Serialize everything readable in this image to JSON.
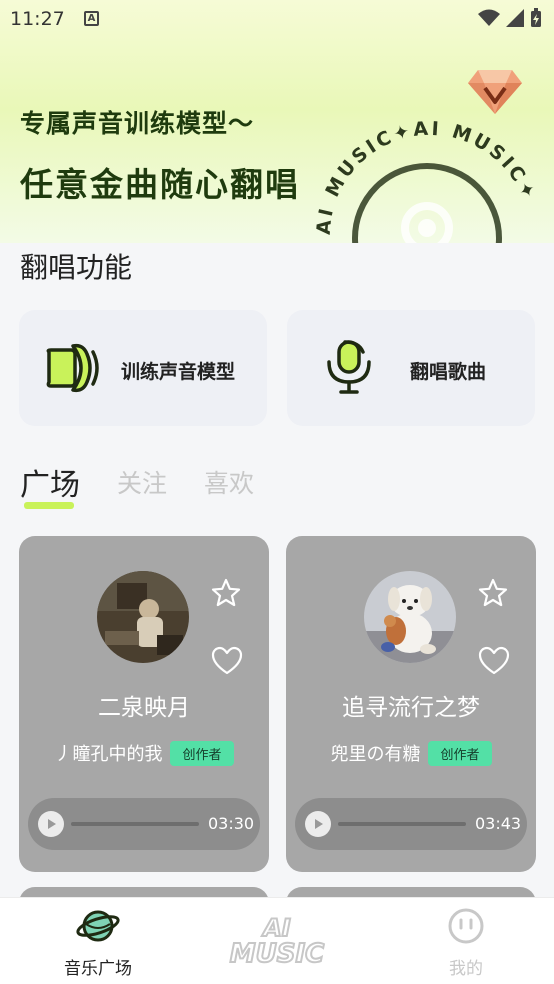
{
  "status_bar": {
    "time": "11:27",
    "notification_icon": "A"
  },
  "banner": {
    "line1": "专属声音训练模型～",
    "line2": "任意金曲随心翻唱",
    "art_text": "AI MUSIC✦AI MUSIC✦"
  },
  "section": {
    "title": "翻唱功能"
  },
  "features": [
    {
      "label": "训练声音模型",
      "icon": "speaker-icon"
    },
    {
      "label": "翻唱歌曲",
      "icon": "microphone-icon"
    }
  ],
  "tabs": [
    {
      "label": "广场",
      "active": true
    },
    {
      "label": "关注",
      "active": false
    },
    {
      "label": "喜欢",
      "active": false
    }
  ],
  "songs": [
    {
      "title": "二泉映月",
      "author": "丿瞳孔中的我",
      "badge": "创作者",
      "duration": "03:30"
    },
    {
      "title": "追寻流行之梦",
      "author": "兜里の有糖",
      "badge": "创作者",
      "duration": "03:43"
    }
  ],
  "bottom_nav": {
    "square_label": "音乐广场",
    "center_logo_line1": "AI",
    "center_logo_line2": "MUSIC",
    "mine_label": "我的"
  },
  "colors": {
    "accent": "#c9f25a",
    "badge": "#53e0a6",
    "card": "#a7a7a7"
  }
}
